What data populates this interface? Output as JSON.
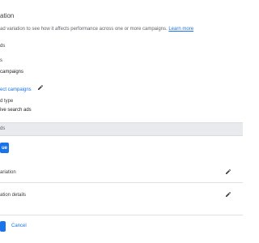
{
  "header": {
    "title": "ation",
    "description": "ad variation to see how it affects performance across one or more campaigns.",
    "learn_more": "Learn more"
  },
  "section_top": {
    "label": "ds"
  },
  "campaigns": {
    "label": "s",
    "value": "campaigns",
    "select_link": "ect campaigns"
  },
  "ad_type": {
    "label": "d type",
    "value": "ive search ads"
  },
  "grey_bar": {
    "text": "ds"
  },
  "primary_button_1": {
    "label": "ue"
  },
  "rows": [
    {
      "label": "ariation"
    },
    {
      "label": "ation details"
    }
  ],
  "footer": {
    "primary_label": "",
    "cancel_label": "Cancel"
  },
  "icons": {
    "edit": "pencil-icon"
  },
  "colors": {
    "accent": "#1a73e8",
    "bar": "#e8eaed"
  }
}
